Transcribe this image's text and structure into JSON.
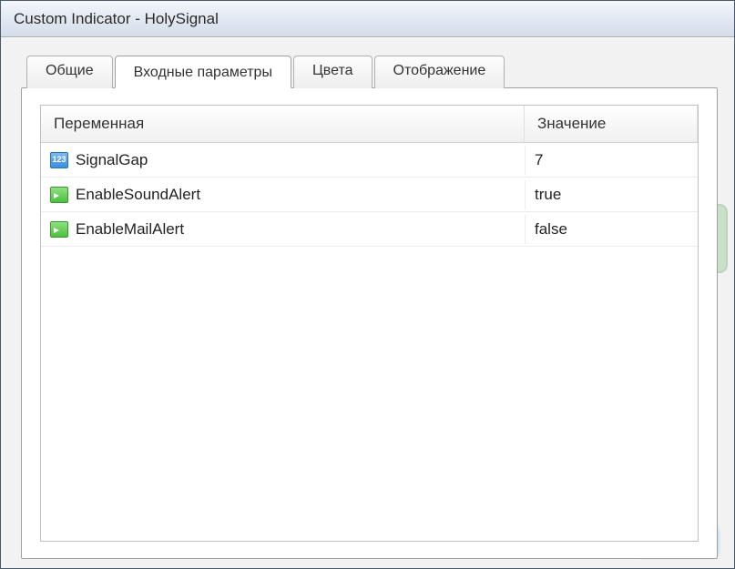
{
  "window": {
    "title": "Custom Indicator - HolySignal"
  },
  "tabs": {
    "items": [
      {
        "label": "Общие"
      },
      {
        "label": "Входные параметры",
        "active": true
      },
      {
        "label": "Цвета"
      },
      {
        "label": "Отображение"
      }
    ]
  },
  "grid": {
    "header_name": "Переменная",
    "header_value": "Значение",
    "rows": [
      {
        "icon": "int",
        "name": "SignalGap",
        "value": "7"
      },
      {
        "icon": "bool",
        "name": "EnableSoundAlert",
        "value": "true"
      },
      {
        "icon": "bool",
        "name": "EnableMailAlert",
        "value": "false"
      }
    ]
  }
}
